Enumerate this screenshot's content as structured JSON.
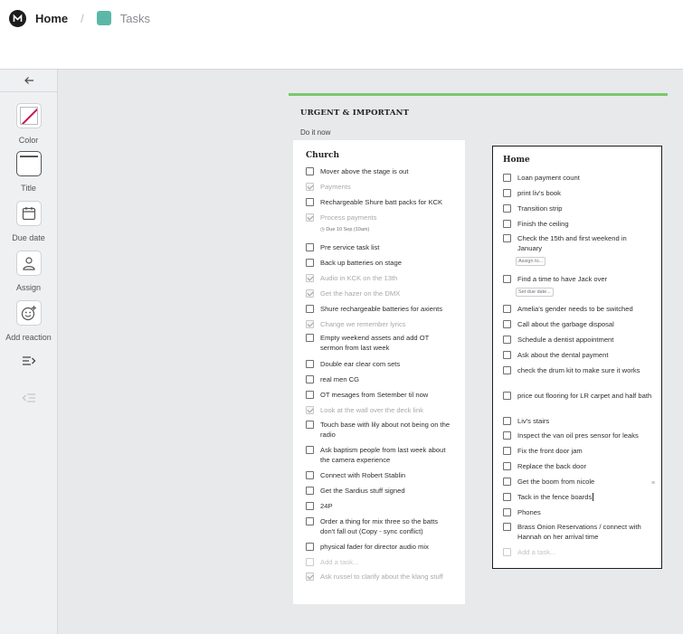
{
  "breadcrumb": {
    "home": "Home",
    "tasks": "Tasks",
    "separator": "/"
  },
  "sidebar": {
    "back_icon": "arrow-left-icon",
    "tools": [
      {
        "label": "Color",
        "icon": "color-swatch-icon"
      },
      {
        "label": "Title",
        "icon": "title-frame-icon"
      },
      {
        "label": "Due date",
        "icon": "calendar-icon"
      },
      {
        "label": "Assign",
        "icon": "person-icon"
      },
      {
        "label": "Add reaction",
        "icon": "smiley-add-icon"
      },
      {
        "label": "",
        "icon": "list-expand-icon"
      },
      {
        "label": "",
        "icon": "list-collapse-icon"
      }
    ]
  },
  "section": {
    "title": "URGENT & IMPORTANT",
    "subtitle": "Do it now",
    "accent_color": "#7bc86c"
  },
  "church": {
    "title": "Church",
    "tasks": [
      {
        "text": "Mover above the stage is out",
        "done": false
      },
      {
        "text": "Payments",
        "done": true
      },
      {
        "text": "Rechargeable Shure batt packs for KCK",
        "done": false
      },
      {
        "text": "Process payments",
        "done": true,
        "due": "Due 10 Sep (10am)"
      },
      {
        "text": "Pre service task list",
        "done": false
      },
      {
        "text": "Back up batteries on stage",
        "done": false
      },
      {
        "text": "Audio in KCK on the 13th",
        "done": true
      },
      {
        "text": "Get the hazer on the DMX",
        "done": true
      },
      {
        "text": "Shure rechargeable batteries for axients",
        "done": false
      },
      {
        "text": "Change we remember lyrics",
        "done": true
      },
      {
        "text": "Empty weekend assets and add OT sermon from last week",
        "done": false
      },
      {
        "text": "Double ear clear com sets",
        "done": false
      },
      {
        "text": "real men CG",
        "done": false
      },
      {
        "text": "OT mesages from Setember til now",
        "done": false
      },
      {
        "text": "Look at the wall over the deck link",
        "done": true
      },
      {
        "text": "Touch base with lily about not being on the radio",
        "done": false
      },
      {
        "text": "Ask baptism people from last week about the camera experience",
        "done": false
      },
      {
        "text": "Connect with Robert Stablin",
        "done": false
      },
      {
        "text": "Get the Sardius stuff signed",
        "done": false
      },
      {
        "text": "24P",
        "done": false
      },
      {
        "text": "Order a thing for mix three so the batts don't fall out (Copy - sync conflict)",
        "done": false
      },
      {
        "text": "physical fader for director audio mix",
        "done": false
      },
      {
        "text": "Add a task...",
        "done": false,
        "placeholder": true
      },
      {
        "text": "Ask russel to clarify about the klang stuff",
        "done": true
      }
    ]
  },
  "home": {
    "title": "Home",
    "assign_placeholder": "Assign to...",
    "due_placeholder": "Set due date...",
    "tasks": [
      {
        "text": "Loan payment count",
        "done": false
      },
      {
        "text": "print liv's book",
        "done": false
      },
      {
        "text": "Transition strip",
        "done": false
      },
      {
        "text": "Finish the ceiling",
        "done": false
      },
      {
        "text": "Check the 15th and first weekend in January",
        "done": false
      },
      {
        "text": "Find a time to have Jack over",
        "done": false
      },
      {
        "text": "Amelia's gender needs to be switched",
        "done": false
      },
      {
        "text": "Call about the garbage disposal",
        "done": false
      },
      {
        "text": "Schedule a dentist appointment",
        "done": false
      },
      {
        "text": "Ask about the dental payment",
        "done": false
      },
      {
        "text": "check the drum kit to make sure it works",
        "done": false
      },
      {
        "text": "price out flooring for LR carpet and half bath",
        "done": false
      },
      {
        "text": "Liv's stairs",
        "done": false
      },
      {
        "text": "Inspect the van oil pres sensor for leaks",
        "done": false
      },
      {
        "text": "Fix the front door jam",
        "done": false
      },
      {
        "text": "Replace the back door",
        "done": false
      },
      {
        "text": "Get the boom from nicole",
        "done": false
      },
      {
        "text": "Tack in the fence boards",
        "done": false
      },
      {
        "text": "Phones",
        "done": false
      },
      {
        "text": "Brass Onion Reservations / connect with Hannah on her arrival time",
        "done": false
      },
      {
        "text": "Add a task...",
        "done": false,
        "placeholder": true
      }
    ]
  }
}
